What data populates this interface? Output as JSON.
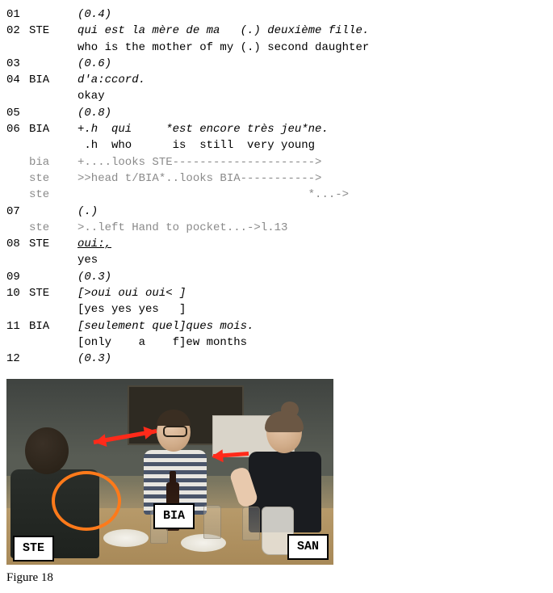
{
  "lines": [
    {
      "ln": "01",
      "sp": "",
      "cls": "italic",
      "txt": "(0.4)"
    },
    {
      "ln": "02",
      "sp": "STE",
      "cls": "italic",
      "txt": "qui est la mère de ma   (.) deuxième fille."
    },
    {
      "ln": "",
      "sp": "",
      "cls": "",
      "txt": "who is the mother of my (.) second daughter"
    },
    {
      "ln": "03",
      "sp": "",
      "cls": "italic",
      "txt": "(0.6)"
    },
    {
      "ln": "04",
      "sp": "BIA",
      "cls": "italic",
      "txt": "d'a:ccord."
    },
    {
      "ln": "",
      "sp": "",
      "cls": "",
      "txt": "okay"
    },
    {
      "ln": "05",
      "sp": "",
      "cls": "italic",
      "txt": "(0.8)"
    },
    {
      "ln": "06",
      "sp": "BIA",
      "cls": "italic",
      "txt": "+.h  qui     *est encore très jeu*ne."
    },
    {
      "ln": "",
      "sp": "",
      "cls": "",
      "txt": " .h  who      is  still  very young"
    },
    {
      "ln": "",
      "sp": "bia",
      "cls": "grey",
      "txt": "+....looks STE--------------------->"
    },
    {
      "ln": "",
      "sp": "ste",
      "cls": "grey",
      "txt": ">>head t/BIA*..looks BIA----------->"
    },
    {
      "ln": "",
      "sp": "ste",
      "cls": "grey",
      "txt": "                                  *...->"
    },
    {
      "ln": "07",
      "sp": "",
      "cls": "italic",
      "txt": "(.)"
    },
    {
      "ln": "",
      "sp": "ste",
      "cls": "grey",
      "txt": ">..left Hand to pocket...->l.13"
    },
    {
      "ln": "08",
      "sp": "STE",
      "cls": "italic underline",
      "txt": "oui:,"
    },
    {
      "ln": "",
      "sp": "",
      "cls": "",
      "txt": "yes"
    },
    {
      "ln": "09",
      "sp": "",
      "cls": "italic",
      "txt": "(0.3)"
    },
    {
      "ln": "10",
      "sp": "STE",
      "cls": "italic",
      "txt": "[>oui oui oui< ]"
    },
    {
      "ln": "",
      "sp": "",
      "cls": "",
      "txt": "[yes yes yes   ]"
    },
    {
      "ln": "11",
      "sp": "BIA",
      "cls": "italic",
      "txt": "[seulement quel]ques mois."
    },
    {
      "ln": "",
      "sp": "",
      "cls": "",
      "txt": "[only    a    f]ew months"
    },
    {
      "ln": "12",
      "sp": "",
      "cls": "italic",
      "txt": "(0.3)"
    }
  ],
  "labels": {
    "ste": "STE",
    "bia": "BIA",
    "san": "SAN"
  },
  "caption": "Figure 18"
}
